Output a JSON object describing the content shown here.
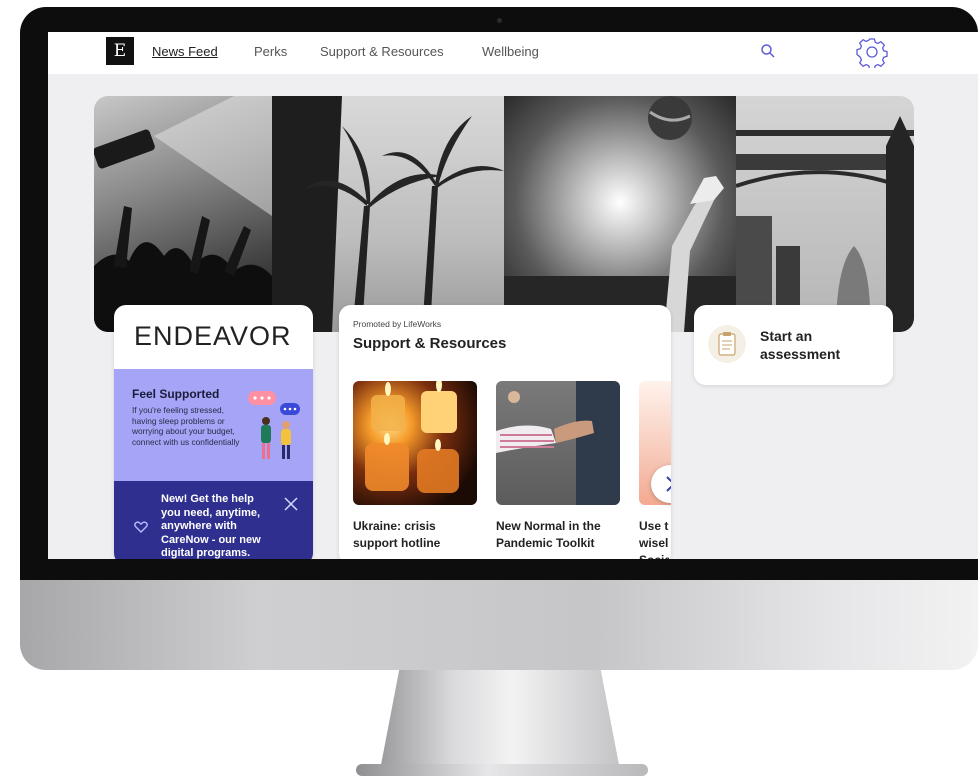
{
  "nav": {
    "logo_letter": "E",
    "items": [
      {
        "label": "News Feed",
        "active": true
      },
      {
        "label": "Perks",
        "active": false
      },
      {
        "label": "Support & Resources",
        "active": false
      },
      {
        "label": "Wellbeing",
        "active": false
      }
    ],
    "search_icon": "search-icon",
    "settings_icon": "gear-icon"
  },
  "hero": {
    "panels": [
      "concert-crowd-photo",
      "palm-trees-photo",
      "volleyball-photo",
      "tower-bridge-photo"
    ]
  },
  "endeavor_card": {
    "title": "ENDEAVOR",
    "support": {
      "title": "Feel Supported",
      "text": "If you're feeling stressed, having sleep problems or worrying about your budget, connect with us confidentially"
    },
    "carenow": {
      "text": "New! Get the help you need, anytime, anywhere with CareNow - our new digital programs."
    }
  },
  "resources_card": {
    "promoted_label": "Promoted by LifeWorks",
    "title": "Support & Resources",
    "tiles": [
      {
        "title": "Ukraine: crisis support hotline",
        "image": "candles-photo"
      },
      {
        "title": "New Normal in the Pandemic Toolkit",
        "image": "elbow-bump-photo"
      },
      {
        "title": "Use t wisel Socia",
        "image": "partial-photo"
      }
    ]
  },
  "assessment_card": {
    "title": "Start an assessment",
    "icon": "clipboard-icon"
  },
  "colors": {
    "support_bg": "#a5a4f6",
    "carenow_bg": "#2f2f8f",
    "accent": "#5b5bd6"
  }
}
